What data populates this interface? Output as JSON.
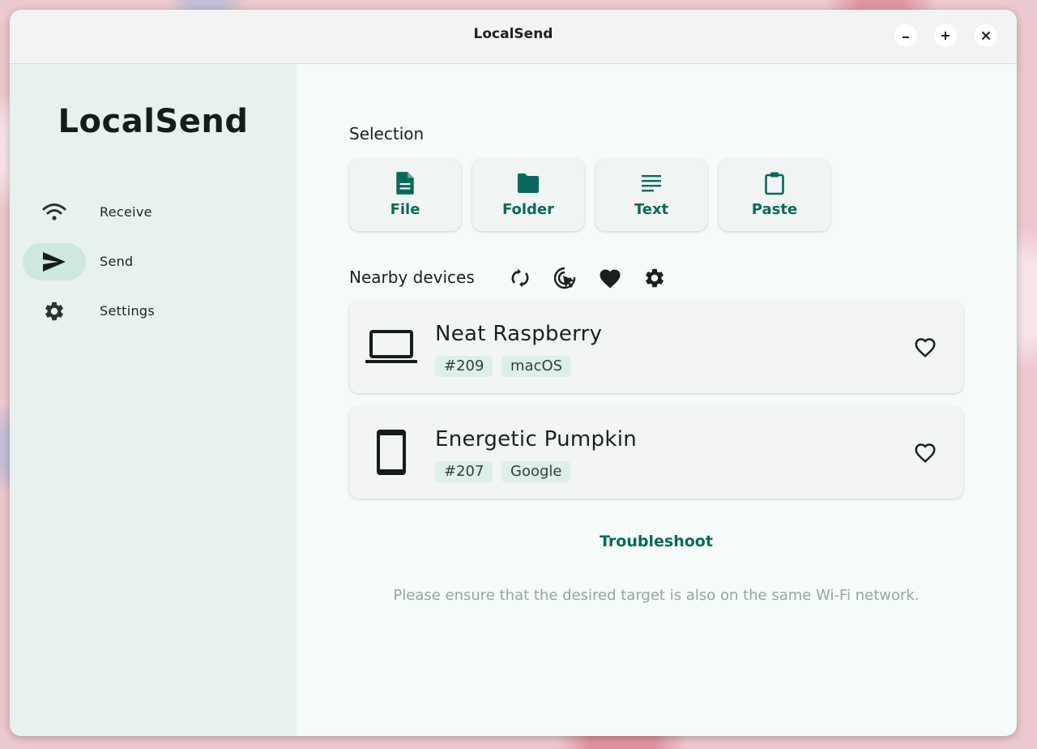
{
  "window": {
    "title": "LocalSend"
  },
  "sidebar": {
    "brand": "LocalSend",
    "items": [
      {
        "label": "Receive",
        "icon": "wifi-icon",
        "active": false
      },
      {
        "label": "Send",
        "icon": "send-icon",
        "active": true
      },
      {
        "label": "Settings",
        "icon": "gear-icon",
        "active": false
      }
    ]
  },
  "main": {
    "selection_label": "Selection",
    "selection_buttons": [
      {
        "label": "File",
        "icon": "file-icon"
      },
      {
        "label": "Folder",
        "icon": "folder-icon"
      },
      {
        "label": "Text",
        "icon": "text-icon"
      },
      {
        "label": "Paste",
        "icon": "clipboard-icon"
      }
    ],
    "nearby_label": "Nearby devices",
    "devices": [
      {
        "name": "Neat Raspberry",
        "tags": [
          "#209",
          "macOS"
        ],
        "icon": "laptop-icon"
      },
      {
        "name": "Energetic Pumpkin",
        "tags": [
          "#207",
          "Google"
        ],
        "icon": "phone-icon"
      }
    ],
    "troubleshoot_label": "Troubleshoot",
    "hint": "Please ensure that the desired target is also on the same Wi-Fi network."
  },
  "colors": {
    "accent": "#086a5c",
    "sidebar_bg": "#e7f2ef",
    "main_bg": "#f4fbf8",
    "active_pill": "#cde8e0"
  }
}
